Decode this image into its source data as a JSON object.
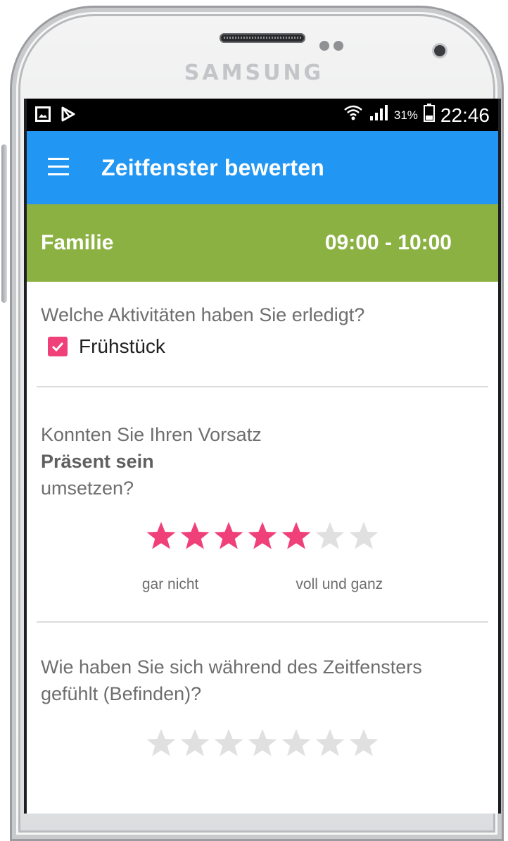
{
  "device": {
    "brand": "SAMSUNG"
  },
  "status_bar": {
    "battery_percent": "31%",
    "time": "22:46"
  },
  "app_bar": {
    "menu_icon": "hamburger-menu-icon",
    "title": "Zeitfenster bewerten",
    "color": "#2196f3"
  },
  "category": {
    "name": "Familie",
    "time_range": "09:00 - 10:00",
    "color": "#8bb143"
  },
  "activities": {
    "question": "Welche Aktivitäten haben Sie erledigt?",
    "items": [
      {
        "label": "Frühstück",
        "checked": true
      }
    ]
  },
  "intention": {
    "question_prefix": "Konnten Sie Ihren Vorsatz",
    "intention_name": "Präsent sein",
    "question_suffix": "umsetzen?",
    "rating": 5,
    "max_rating": 7,
    "label_low": "gar nicht",
    "label_high": "voll und ganz"
  },
  "wellbeing": {
    "question": "Wie haben Sie sich während des Zeitfensters gefühlt (Befinden)?",
    "rating": 0,
    "max_rating": 7
  },
  "colors": {
    "accent": "#f0407a",
    "star_inactive": "#e0e0e0"
  }
}
